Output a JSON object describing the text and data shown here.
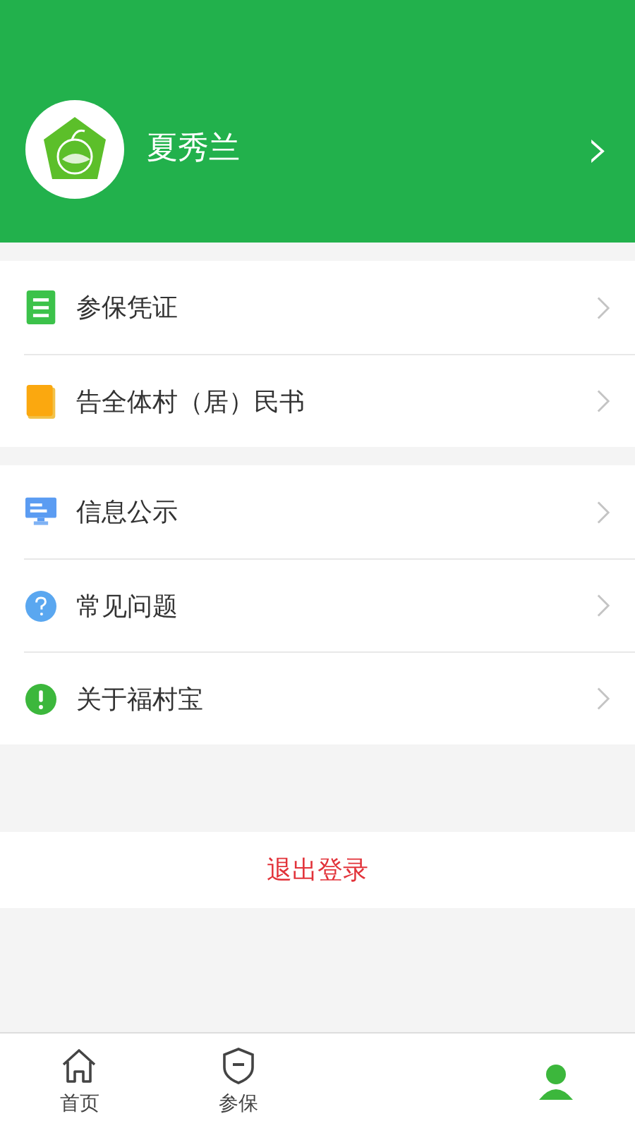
{
  "profile": {
    "name": "夏秀兰",
    "chevron": "›"
  },
  "groups": [
    [
      {
        "kind": "doc",
        "label": "参保凭证"
      },
      {
        "kind": "book",
        "label": "告全体村（居）民书"
      }
    ],
    [
      {
        "kind": "monitor",
        "label": "信息公示"
      },
      {
        "kind": "question",
        "label": "常见问题"
      },
      {
        "kind": "info",
        "label": "关于福村宝"
      }
    ]
  ],
  "logout": "退出登录",
  "tabs": [
    {
      "kind": "home",
      "label": "首页",
      "selected": false
    },
    {
      "kind": "shield",
      "label": "参保",
      "selected": false
    },
    {
      "kind": "user",
      "selected": true
    }
  ]
}
